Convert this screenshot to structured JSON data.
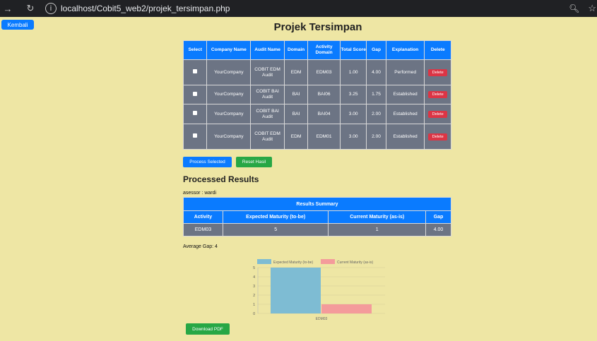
{
  "browser": {
    "url": "localhost/Cobit5_web2/projek_tersimpan.php"
  },
  "back_label": "Kembali",
  "title": "Projek Tersimpan",
  "projects_table": {
    "headers": [
      "Select",
      "Company Name",
      "Audit Name",
      "Domain",
      "Activity Domain",
      "Total Score",
      "Gap",
      "Explanation",
      "Delete"
    ],
    "rows": [
      {
        "company": "YourCompany",
        "audit": "COBIT EDM Audit",
        "domain": "EDM",
        "activity": "EDM03",
        "score": "1.00",
        "gap": "4.00",
        "explanation": "Performed",
        "delete": "Delete"
      },
      {
        "company": "YourCompany",
        "audit": "COBIT BAI Audit",
        "domain": "BAI",
        "activity": "BAI06",
        "score": "3.25",
        "gap": "1.75",
        "explanation": "Established",
        "delete": "Delete"
      },
      {
        "company": "YourCompany",
        "audit": "COBIT BAI Audit",
        "domain": "BAI",
        "activity": "BAI04",
        "score": "3.00",
        "gap": "2.00",
        "explanation": "Established",
        "delete": "Delete"
      },
      {
        "company": "YourCompany",
        "audit": "COBIT EDM Audit",
        "domain": "EDM",
        "activity": "EDM01",
        "score": "3.00",
        "gap": "2.00",
        "explanation": "Established",
        "delete": "Delete"
      }
    ]
  },
  "buttons": {
    "process": "Process Selected",
    "reset": "Reset Hasil",
    "download": "Download PDF"
  },
  "processed": {
    "title": "Processed Results",
    "assessor": "asessor : wardi",
    "summary_title": "Results Summary",
    "headers": [
      "Activity",
      "Expected Maturity (to-be)",
      "Current Maturity (as-is)",
      "Gap"
    ],
    "rows": [
      {
        "activity": "EDM03",
        "expected": "5",
        "current": "1",
        "gap": "4.00"
      }
    ],
    "average_gap": "Average Gap: 4"
  },
  "colors": {
    "background": "#eee6a4",
    "primary": "#0a7bff",
    "success": "#27a745",
    "danger": "#dc3545",
    "table_cell": "#6c7484",
    "expected_bar": "#7ebcd3",
    "current_bar": "#f49b9b"
  },
  "icons": {
    "back": "arrow-left-icon",
    "reload": "reload-icon",
    "site_info": "site-info-icon",
    "zoom": "zoom-icon",
    "bookmark": "star-icon"
  },
  "chart_data": {
    "type": "bar",
    "categories": [
      "EDM03"
    ],
    "series": [
      {
        "name": "Expected Maturity (to-be)",
        "values": [
          5
        ],
        "color": "#7ebcd3"
      },
      {
        "name": "Current Maturity (as-is)",
        "values": [
          1
        ],
        "color": "#f49b9b"
      }
    ],
    "ylim": [
      0,
      5
    ],
    "yticks": [
      "0",
      "1",
      "2",
      "3",
      "4",
      "5"
    ],
    "legend_position": "top",
    "grid": true
  }
}
